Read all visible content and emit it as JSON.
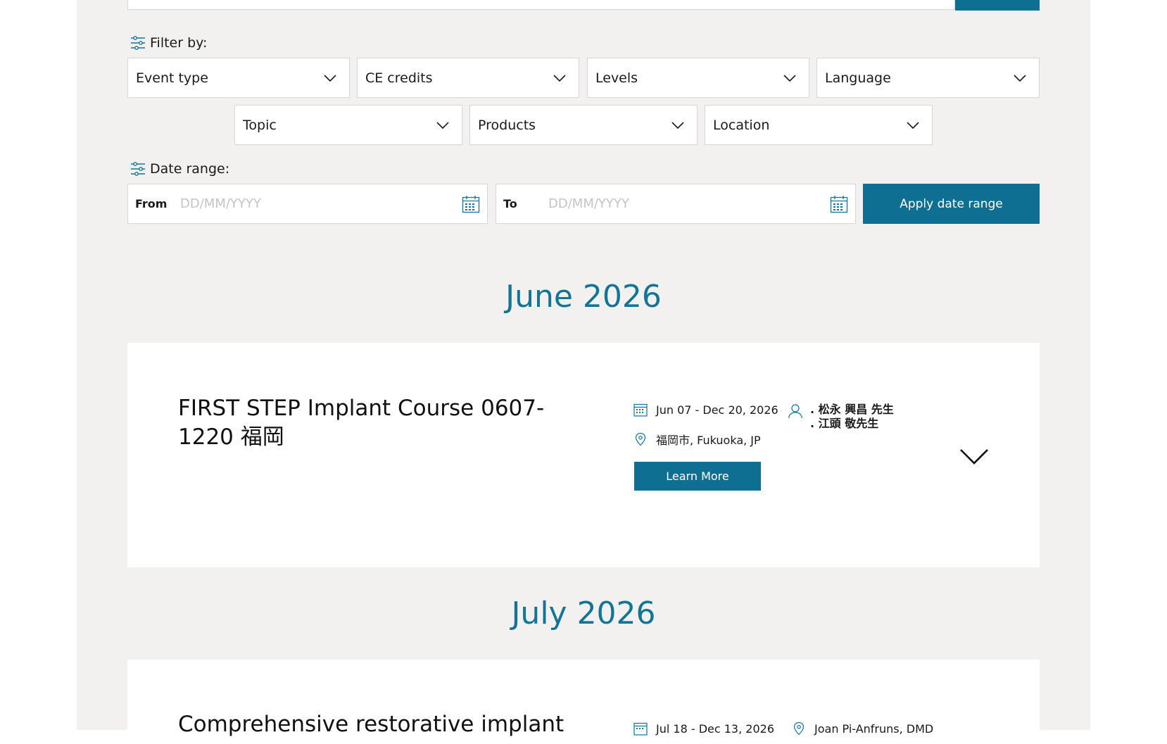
{
  "filters": {
    "title": "Filter by:",
    "row1": [
      {
        "label": "Event type"
      },
      {
        "label": "CE credits"
      },
      {
        "label": "Levels"
      },
      {
        "label": "Language"
      }
    ],
    "row2": [
      {
        "label": "Topic"
      },
      {
        "label": "Products"
      },
      {
        "label": "Location"
      }
    ]
  },
  "date_range": {
    "title": "Date range:",
    "from_label": "From",
    "from_placeholder": "DD/MM/YYYY",
    "to_label": "To",
    "to_placeholder": "DD/MM/YYYY",
    "apply_label": "Apply date range"
  },
  "months": [
    {
      "heading": "June 2026",
      "event": {
        "title": "FIRST STEP Implant Course 0607-1220 福岡",
        "dates": "Jun 07 - Dec 20, 2026",
        "location": "福岡市, Fukuoka, JP",
        "presenters": [
          ". 松永 興昌 先生",
          ". 江頭 敬先生"
        ],
        "learn_more": "Learn More"
      }
    },
    {
      "heading": "July 2026",
      "event": {
        "title": "Comprehensive restorative implant",
        "dates": "Jul 18 - Dec 13, 2026",
        "presenter": "Joan Pi-Anfruns, DMD"
      }
    }
  ],
  "colors": {
    "accent": "#0f6f93",
    "heading": "#127596",
    "panel_bg": "#f2f1ef"
  }
}
